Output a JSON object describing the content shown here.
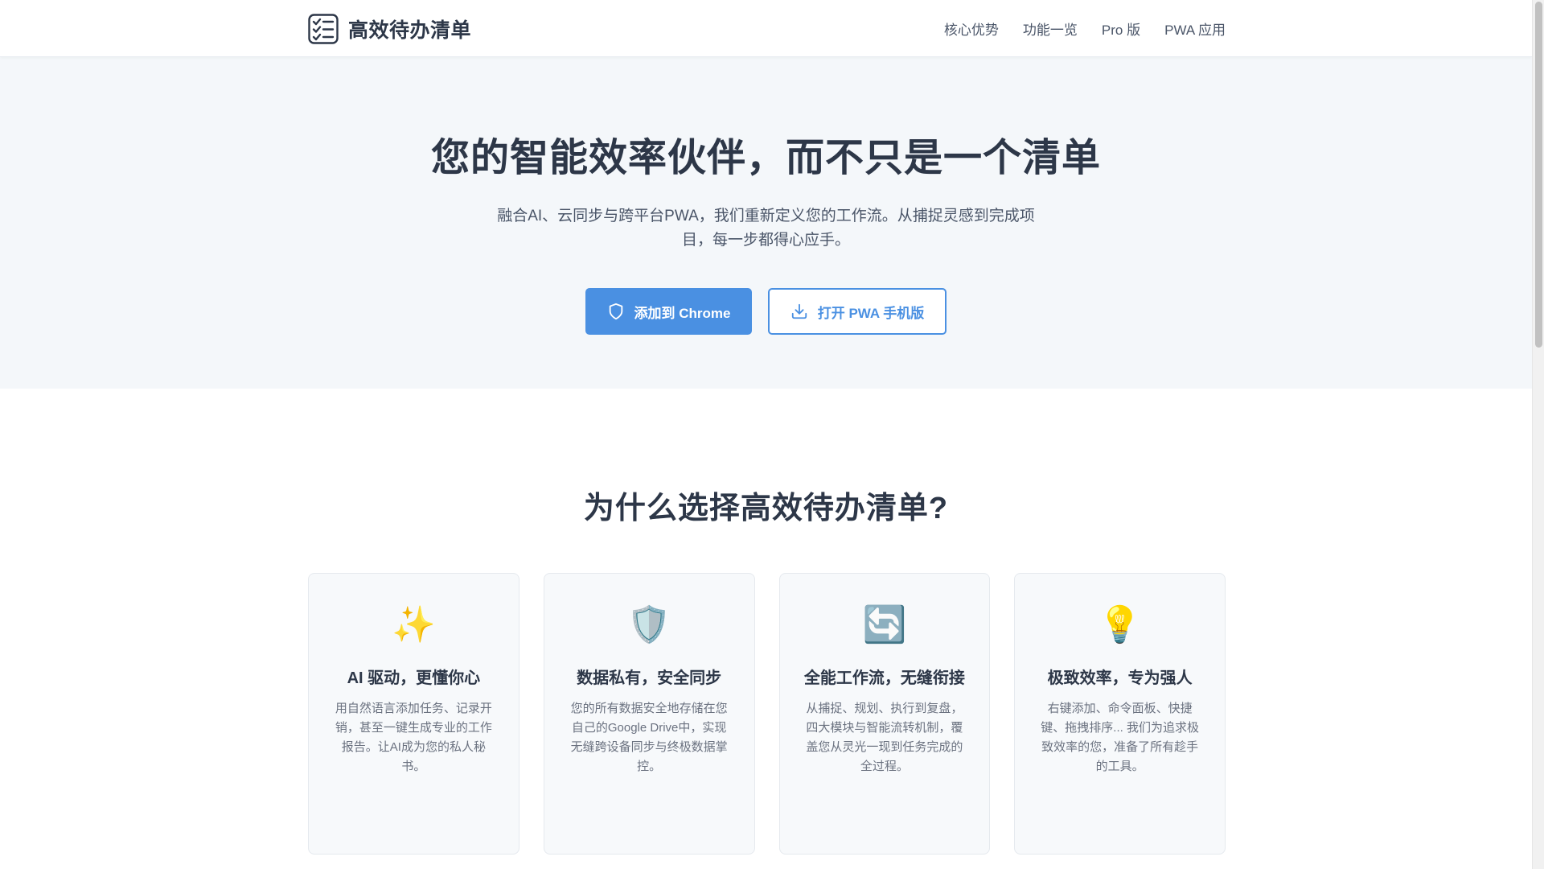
{
  "header": {
    "brand_title": "高效待办清单",
    "nav": [
      "核心优势",
      "功能一览",
      "Pro 版",
      "PWA 应用"
    ]
  },
  "hero": {
    "title": "您的智能效率伙伴，而不只是一个清单",
    "subtitle": "融合AI、云同步与跨平台PWA，我们重新定义您的工作流。从捕捉灵感到完成项目，每一步都得心应手。",
    "primary_button": "添加到 Chrome",
    "secondary_button": "打开 PWA 手机版"
  },
  "features": {
    "heading": "为什么选择高效待办清单?",
    "cards": [
      {
        "icon": "✨",
        "icon_name": "sparkles-icon",
        "title": "AI 驱动，更懂你心",
        "desc": "用自然语言添加任务、记录开销，甚至一键生成专业的工作报告。让AI成为您的私人秘书。"
      },
      {
        "icon": "🛡️",
        "icon_name": "shield-icon",
        "title": "数据私有，安全同步",
        "desc": "您的所有数据安全地存储在您自己的Google Drive中，实现无缝跨设备同步与终极数据掌控。"
      },
      {
        "icon": "🔄",
        "icon_name": "sync-icon",
        "title": "全能工作流，无缝衔接",
        "desc": "从捕捉、规划、执行到复盘，四大模块与智能流转机制，覆盖您从灵光一现到任务完成的全过程。"
      },
      {
        "icon": "💡",
        "icon_name": "lightbulb-icon",
        "title": "极致效率，专为强人",
        "desc": "右键添加、命令面板、快捷键、拖拽排序... 我们为追求极致效率的您，准备了所有趁手的工具。"
      }
    ]
  },
  "colors": {
    "accent": "#4a90e2",
    "hero_bg": "#f4f7fa",
    "heading": "#2d3748",
    "muted": "#6b7280"
  }
}
